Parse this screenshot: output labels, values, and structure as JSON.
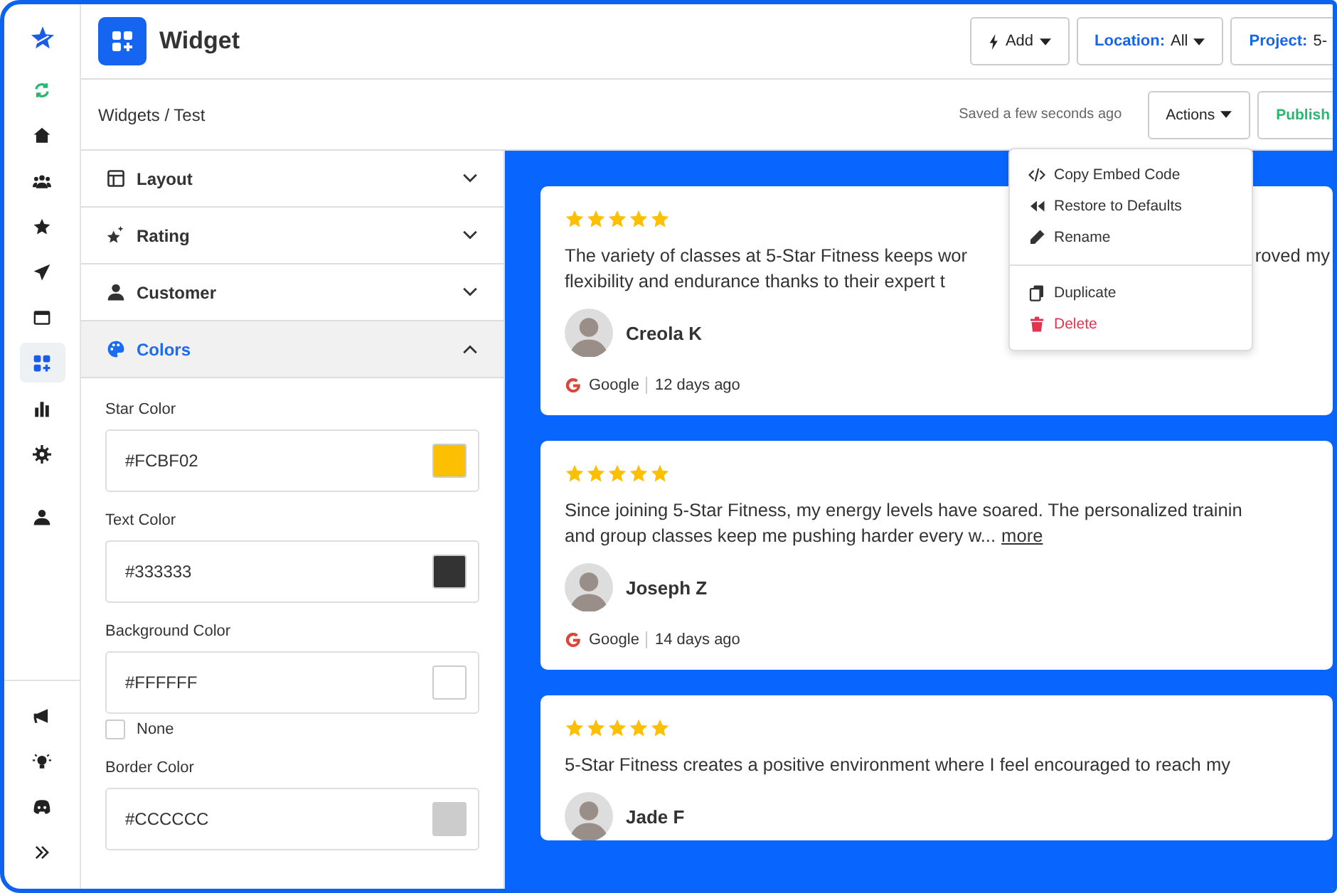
{
  "sidebar": {
    "items": [
      {
        "selected": false
      },
      {
        "selected": false
      },
      {
        "selected": false
      },
      {
        "selected": false
      },
      {
        "selected": false
      },
      {
        "selected": false
      },
      {
        "selected": true
      },
      {
        "selected": false
      },
      {
        "selected": false
      },
      {
        "selected": false
      }
    ],
    "bottom_items": [
      {
        "selected": false
      },
      {
        "selected": false
      },
      {
        "selected": false
      },
      {
        "selected": false
      }
    ]
  },
  "header": {
    "title": "Widget",
    "buttons": [
      {
        "kind": "add",
        "label": "Add"
      },
      {
        "kind": "filter",
        "label": "Location:",
        "value": "All"
      },
      {
        "kind": "filter",
        "label": "Project:",
        "value": "5-"
      }
    ]
  },
  "breadcrumb": {
    "items": [
      "Widgets",
      "Test"
    ],
    "separator": "/"
  },
  "saved_status": "Saved a few seconds ago",
  "actions_button": "Actions",
  "publish_button": "Publish",
  "actions_menu": [
    [
      {
        "kind": "code",
        "label": "Copy Embed Code",
        "danger": false
      },
      {
        "kind": "restore",
        "label": "Restore to Defaults",
        "danger": false
      },
      {
        "kind": "rename",
        "label": "Rename",
        "danger": false
      }
    ],
    [
      {
        "kind": "duplicate",
        "label": "Duplicate",
        "danger": false
      },
      {
        "kind": "delete",
        "label": "Delete",
        "danger": true
      }
    ]
  ],
  "sections": [
    {
      "kind": "layout",
      "label": "Layout",
      "expanded": false
    },
    {
      "kind": "rating",
      "label": "Rating",
      "expanded": false
    },
    {
      "kind": "customer",
      "label": "Customer",
      "expanded": false
    },
    {
      "kind": "colors",
      "label": "Colors",
      "expanded": true
    }
  ],
  "color_fields": [
    {
      "label": "Star Color",
      "value": "#FCBF02"
    },
    {
      "label": "Text Color",
      "value": "#333333"
    },
    {
      "label": "Background Color",
      "value": "#FFFFFF",
      "none_option": {
        "label": "None",
        "checked": false
      }
    },
    {
      "label": "Border Color",
      "value": "#CCCCCC"
    }
  ],
  "reviews": [
    {
      "stars": 5,
      "lines": [
        [
          "The variety of classes at 5-Star Fitness keeps wor",
          "roved my"
        ],
        [
          "flexibility and endurance thanks to their expert t"
        ]
      ],
      "name": "Creola K",
      "source": "Google",
      "age": "12 days ago"
    },
    {
      "stars": 5,
      "lines": [
        [
          "Since joining 5-Star Fitness, my energy levels have soared. The personalized trainin"
        ],
        [
          "and group classes keep me pushing harder every w..."
        ]
      ],
      "more": "more",
      "name": "Joseph Z",
      "source": "Google",
      "age": "14 days ago"
    },
    {
      "stars": 5,
      "lines": [
        [
          "5-Star Fitness creates a positive environment where I feel encouraged to reach my"
        ]
      ],
      "name": "Jade F"
    }
  ]
}
